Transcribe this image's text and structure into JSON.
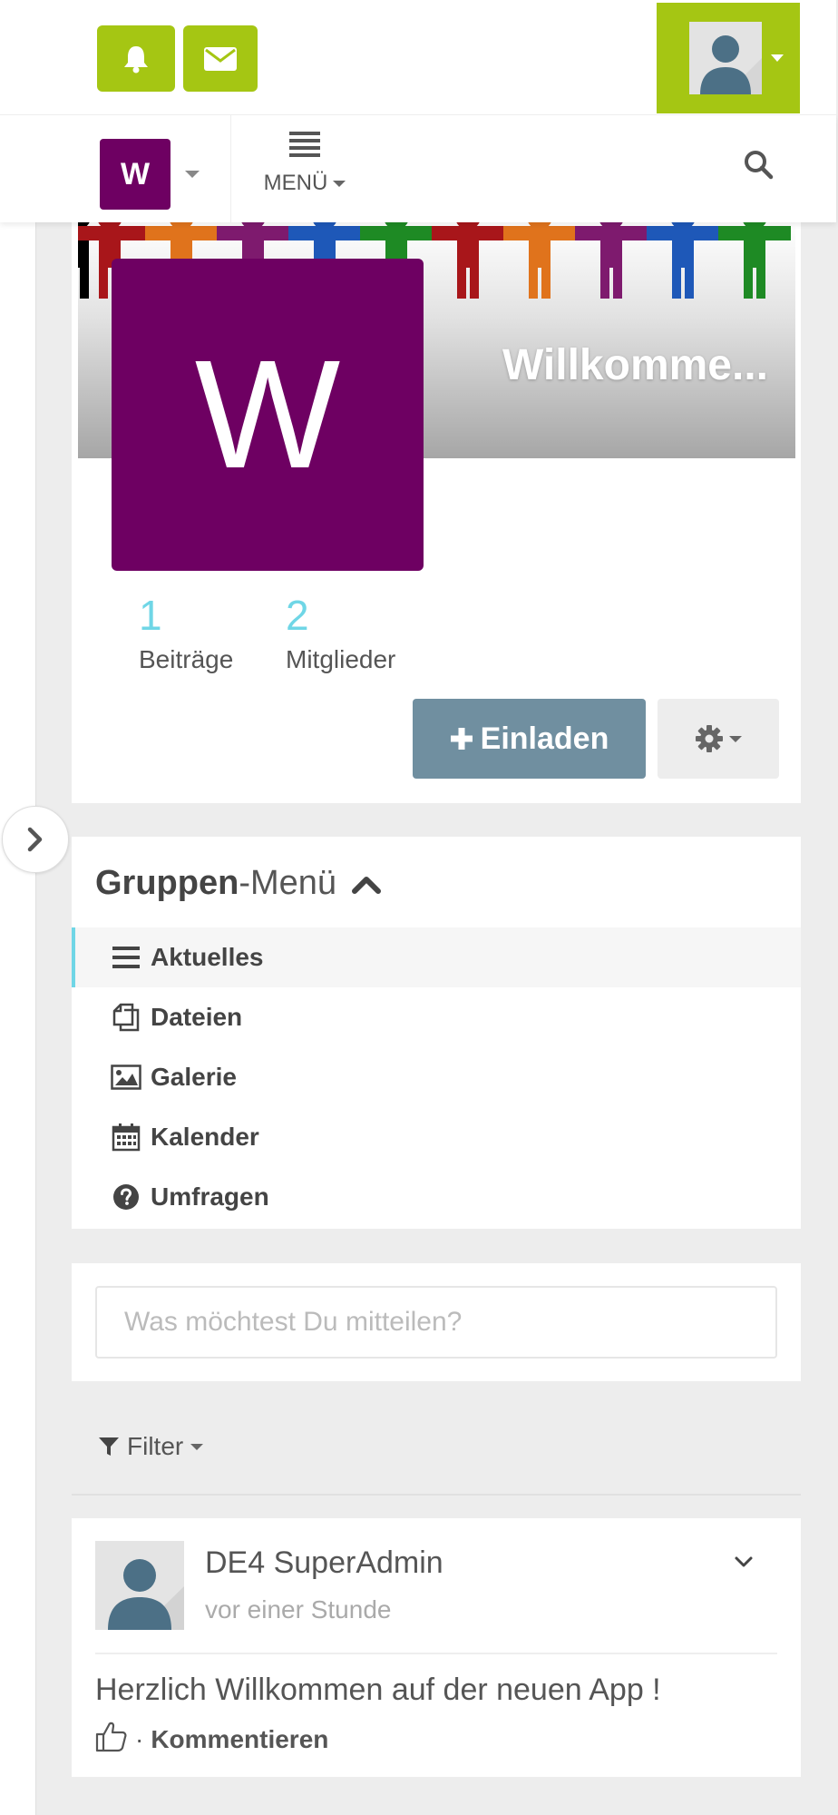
{
  "topbar": {
    "notifications_icon": "bell-icon",
    "messages_icon": "envelope-icon",
    "accent_color": "#a5c613"
  },
  "navbar": {
    "space_initial": "W",
    "menu_label": "MENÜ",
    "search_icon": "search-icon"
  },
  "space": {
    "initial": "W",
    "banner_title": "Willkomme...",
    "color": "#6e0062",
    "stats": [
      {
        "value": "1",
        "label": "Beiträge"
      },
      {
        "value": "2",
        "label": "Mitglieder"
      }
    ],
    "invite_label": "Einladen"
  },
  "group_menu": {
    "title_bold": "Gruppen",
    "title_rest": "-Menü",
    "items": [
      {
        "label": "Aktuelles",
        "icon": "list-icon",
        "active": true
      },
      {
        "label": "Dateien",
        "icon": "files-icon",
        "active": false
      },
      {
        "label": "Galerie",
        "icon": "image-icon",
        "active": false
      },
      {
        "label": "Kalender",
        "icon": "calendar-icon",
        "active": false
      },
      {
        "label": "Umfragen",
        "icon": "question-circle-icon",
        "active": false
      }
    ]
  },
  "post_box": {
    "placeholder": "Was möchtest Du mitteilen?"
  },
  "filter": {
    "label": "Filter"
  },
  "entry": {
    "author": "DE4 SuperAdmin",
    "time": "vor einer Stunde",
    "text": "Herzlich Willkommen auf der neuen App !",
    "separator": "·",
    "comment_label": "Kommentieren"
  }
}
